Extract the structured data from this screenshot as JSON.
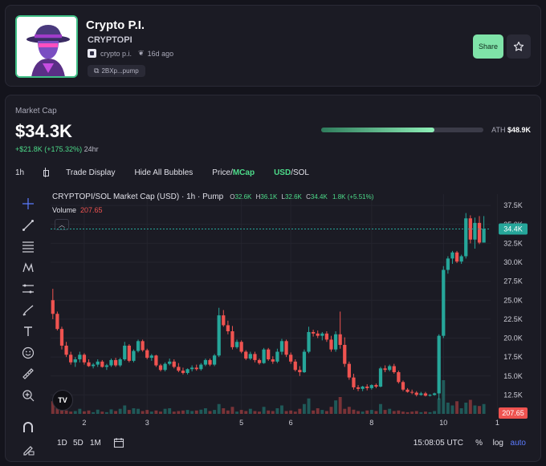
{
  "token": {
    "name": "Crypto P.I.",
    "ticker": "CRYPTOPI",
    "creator": "crypto p.i.",
    "age": "16d ago",
    "address": "2BXp...pump",
    "share_label": "Share"
  },
  "market": {
    "label": "Market Cap",
    "value": "$34.3K",
    "change": "+$21.8K (+175.32%)",
    "timeframe": "24hr",
    "ath_label": "ATH",
    "ath_value": "$48.9K",
    "ath_progress": 0.7
  },
  "toolbar": {
    "interval": "1h",
    "trade_display": "Trade Display",
    "hide_bubbles": "Hide All Bubbles",
    "price_label": "Price/",
    "mcap_label": "MCap",
    "usd_label": "USD",
    "sol_label": "/SOL"
  },
  "chart_header": {
    "title": "CRYPTOPI/SOL Market Cap (USD) · 1h · Pump",
    "o_label": "O",
    "o_value": "32.6K",
    "h_label": "H",
    "h_value": "36.1K",
    "l_label": "L",
    "l_value": "32.6K",
    "c_label": "C",
    "c_value": "34.4K",
    "change": "1.8K (+5.51%)",
    "volume_label": "Volume",
    "volume_value": "207.65"
  },
  "bottom": {
    "ranges": [
      "1D",
      "5D",
      "1M"
    ],
    "time": "15:08:05 UTC",
    "percent": "%",
    "log": "log",
    "auto": "auto"
  },
  "colors": {
    "up": "#26a69a",
    "down": "#ef5350",
    "accent": "#7fe3a8",
    "current_price": "#26a69a",
    "volume_badge": "#ef5350"
  },
  "icons": [
    "crosshair-icon",
    "trend-line-icon",
    "fib-lines-icon",
    "pattern-icon",
    "measure-lines-icon",
    "brush-icon",
    "text-icon",
    "emoji-icon",
    "ruler-icon",
    "zoom-in-icon",
    "magnet-icon",
    "lock-pencil-icon",
    "calendar-icon",
    "copy-icon",
    "star-icon"
  ],
  "chart_data": {
    "type": "candlestick",
    "y_unit": "K USD",
    "ylim": [
      10000,
      39000
    ],
    "y_ticks": [
      12500,
      15000,
      17500,
      20000,
      22500,
      25000,
      27500,
      30000,
      32500,
      35000,
      37500
    ],
    "y_tick_labels": [
      "12.5K",
      "15.0K",
      "17.5K",
      "20.0K",
      "22.5K",
      "25.0K",
      "27.5K",
      "30.0K",
      "32.5K",
      "35.0K",
      "37.5K"
    ],
    "x_labels": [
      "2",
      "3",
      "5",
      "6",
      "8",
      "10",
      "1"
    ],
    "x_label_index": [
      7,
      21,
      42,
      53,
      71,
      87,
      99
    ],
    "current_value_label": "34.4K",
    "volume_value_label": "207.65",
    "candles": [
      [
        25000,
        26500,
        22500,
        23200
      ],
      [
        23200,
        23500,
        21000,
        21200
      ],
      [
        21200,
        21500,
        18500,
        19000
      ],
      [
        19000,
        19500,
        17500,
        17800
      ],
      [
        17800,
        18200,
        16500,
        16800
      ],
      [
        16800,
        17500,
        16200,
        17200
      ],
      [
        17200,
        18200,
        16800,
        17800
      ],
      [
        17800,
        18000,
        16500,
        16800
      ],
      [
        16800,
        17200,
        16200,
        16300
      ],
      [
        16300,
        16700,
        16000,
        16500
      ],
      [
        16500,
        17200,
        16200,
        16900
      ],
      [
        16900,
        17100,
        16100,
        16200
      ],
      [
        16200,
        16600,
        15800,
        16400
      ],
      [
        16400,
        17300,
        16200,
        17100
      ],
      [
        17100,
        17400,
        16200,
        16400
      ],
      [
        16400,
        17400,
        16200,
        17200
      ],
      [
        17200,
        19500,
        17000,
        19000
      ],
      [
        19000,
        19200,
        16800,
        17000
      ],
      [
        17000,
        18500,
        16800,
        18300
      ],
      [
        18300,
        19800,
        18100,
        19600
      ],
      [
        19600,
        19800,
        18200,
        18400
      ],
      [
        18400,
        18600,
        17200,
        17400
      ],
      [
        17400,
        17900,
        17000,
        17700
      ],
      [
        17700,
        17800,
        16200,
        16400
      ],
      [
        16400,
        16600,
        15600,
        15800
      ],
      [
        15800,
        16800,
        15600,
        16600
      ],
      [
        16600,
        17300,
        16400,
        16900
      ],
      [
        16900,
        17200,
        16000,
        16200
      ],
      [
        16200,
        16700,
        15500,
        15700
      ],
      [
        15700,
        16100,
        15200,
        15400
      ],
      [
        15400,
        16000,
        15200,
        15900
      ],
      [
        15900,
        16400,
        15600,
        16100
      ],
      [
        16100,
        16500,
        15700,
        15900
      ],
      [
        15900,
        16700,
        15700,
        16500
      ],
      [
        16500,
        17300,
        16300,
        17100
      ],
      [
        17100,
        17300,
        16300,
        16500
      ],
      [
        16500,
        17900,
        16300,
        17700
      ],
      [
        17700,
        24000,
        17500,
        23000
      ],
      [
        23000,
        23700,
        21500,
        21700
      ],
      [
        21700,
        22300,
        20500,
        20900
      ],
      [
        20900,
        21600,
        18500,
        18800
      ],
      [
        18800,
        19800,
        18600,
        19500
      ],
      [
        19500,
        19700,
        18000,
        18200
      ],
      [
        18200,
        18400,
        17100,
        17300
      ],
      [
        17300,
        18200,
        17100,
        17900
      ],
      [
        17900,
        18200,
        16800,
        17100
      ],
      [
        17100,
        17300,
        16500,
        16700
      ],
      [
        16700,
        18700,
        16600,
        18500
      ],
      [
        18500,
        18700,
        17000,
        17200
      ],
      [
        17200,
        17600,
        16600,
        16900
      ],
      [
        16900,
        18600,
        16700,
        18200
      ],
      [
        18200,
        19900,
        17800,
        19600
      ],
      [
        19600,
        19800,
        17500,
        17800
      ],
      [
        17800,
        18100,
        16600,
        16900
      ],
      [
        16900,
        17200,
        15600,
        15800
      ],
      [
        15800,
        16300,
        15000,
        15500
      ],
      [
        15500,
        18500,
        15400,
        18200
      ],
      [
        18200,
        21500,
        18000,
        20800
      ],
      [
        20800,
        21100,
        20200,
        20600
      ],
      [
        20600,
        21000,
        20000,
        20300
      ],
      [
        20300,
        20800,
        19700,
        20600
      ],
      [
        20600,
        20900,
        19500,
        19800
      ],
      [
        19800,
        20300,
        18200,
        18500
      ],
      [
        18500,
        20900,
        18200,
        20500
      ],
      [
        20500,
        23500,
        18600,
        19100
      ],
      [
        19100,
        20100,
        16200,
        16600
      ],
      [
        16600,
        16900,
        14500,
        14800
      ],
      [
        14800,
        15300,
        13200,
        13500
      ],
      [
        13500,
        13800,
        13000,
        13300
      ],
      [
        13300,
        13700,
        13000,
        13600
      ],
      [
        13600,
        13900,
        13100,
        13400
      ],
      [
        13400,
        13900,
        13200,
        13800
      ],
      [
        13800,
        14000,
        13400,
        13600
      ],
      [
        13600,
        16200,
        13500,
        16000
      ],
      [
        16000,
        16400,
        15500,
        15800
      ],
      [
        15800,
        16500,
        15600,
        16300
      ],
      [
        16300,
        16600,
        15300,
        15500
      ],
      [
        15500,
        15700,
        14000,
        14200
      ],
      [
        14200,
        14400,
        13000,
        13200
      ],
      [
        13200,
        13400,
        12800,
        12900
      ],
      [
        12900,
        13200,
        12600,
        12800
      ],
      [
        12800,
        13000,
        12300,
        12500
      ],
      [
        12500,
        12900,
        12400,
        12700
      ],
      [
        12700,
        12900,
        12300,
        12400
      ],
      [
        12400,
        12600,
        12300,
        12500
      ],
      [
        12500,
        12800,
        12400,
        12700
      ],
      [
        12700,
        20500,
        11900,
        20300
      ],
      [
        20300,
        29500,
        20000,
        29000
      ],
      [
        29000,
        30800,
        28500,
        30500
      ],
      [
        30500,
        31500,
        29800,
        31300
      ],
      [
        31300,
        31500,
        29900,
        30100
      ],
      [
        30100,
        31000,
        29800,
        30800
      ],
      [
        30800,
        36500,
        30500,
        35800
      ],
      [
        35800,
        36200,
        32500,
        33000
      ],
      [
        33000,
        35900,
        31800,
        35200
      ],
      [
        35200,
        36100,
        32400,
        32600
      ],
      [
        32600,
        36100,
        32600,
        34400
      ]
    ],
    "volumes": [
      45,
      30,
      20,
      12,
      8,
      10,
      18,
      9,
      12,
      6,
      15,
      8,
      6,
      16,
      10,
      18,
      30,
      14,
      20,
      18,
      10,
      14,
      8,
      12,
      8,
      18,
      20,
      8,
      10,
      12,
      14,
      10,
      12,
      15,
      20,
      10,
      14,
      35,
      20,
      12,
      25,
      8,
      14,
      10,
      18,
      10,
      8,
      25,
      12,
      10,
      20,
      30,
      10,
      12,
      8,
      18,
      35,
      55,
      12,
      20,
      14,
      10,
      25,
      48,
      60,
      18,
      25,
      15,
      10,
      8,
      12,
      14,
      10,
      35,
      14,
      18,
      10,
      12,
      8,
      6,
      8,
      10,
      6,
      8,
      6,
      10,
      55,
      120,
      40,
      30,
      45,
      20,
      40,
      50,
      30,
      28,
      35
    ]
  }
}
